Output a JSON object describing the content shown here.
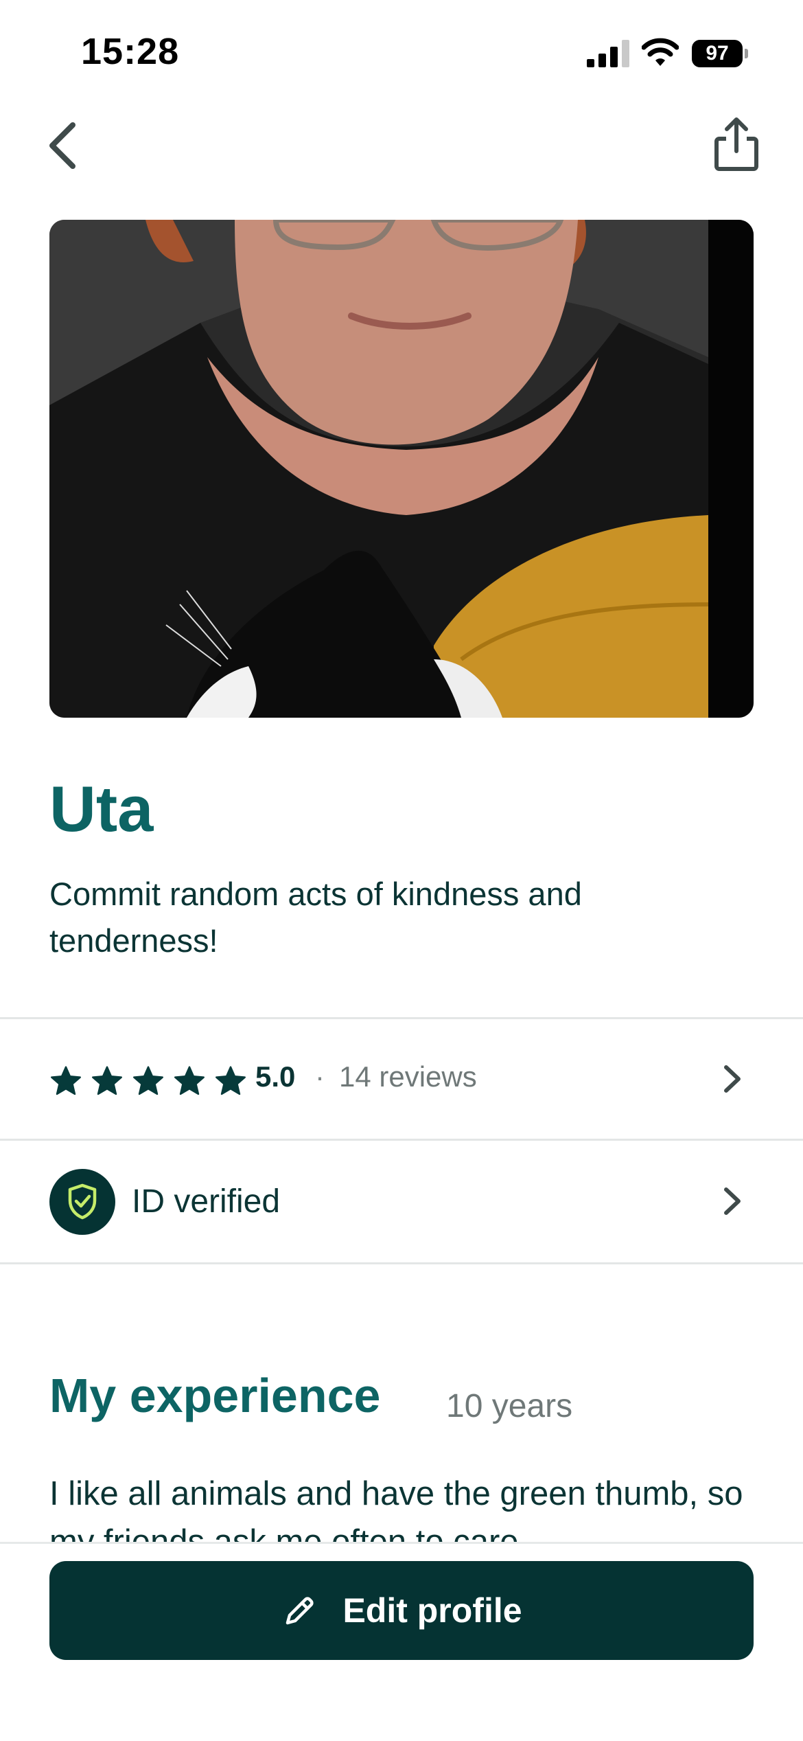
{
  "status_bar": {
    "time": "15:28",
    "battery": "97"
  },
  "profile": {
    "name": "Uta",
    "tagline": "Commit random acts of kindness and tenderness!"
  },
  "reviews": {
    "rating": "5.0",
    "separator": "·",
    "count_label": "14 reviews",
    "stars": 5
  },
  "verification": {
    "label": "ID verified"
  },
  "experience": {
    "title": "My experience",
    "years": "10 years",
    "text": "I like all animals and have the green thumb, so my friends ask me often to care"
  },
  "actions": {
    "edit_profile_label": "Edit profile"
  },
  "colors": {
    "brand_dark": "#053333",
    "heading_teal": "#0d6464",
    "shield_accent": "#c5ec6a"
  },
  "icons": {
    "back": "chevron-left-icon",
    "share": "share-icon",
    "star": "star-icon",
    "shield": "shield-check-icon",
    "pencil": "pencil-icon"
  }
}
